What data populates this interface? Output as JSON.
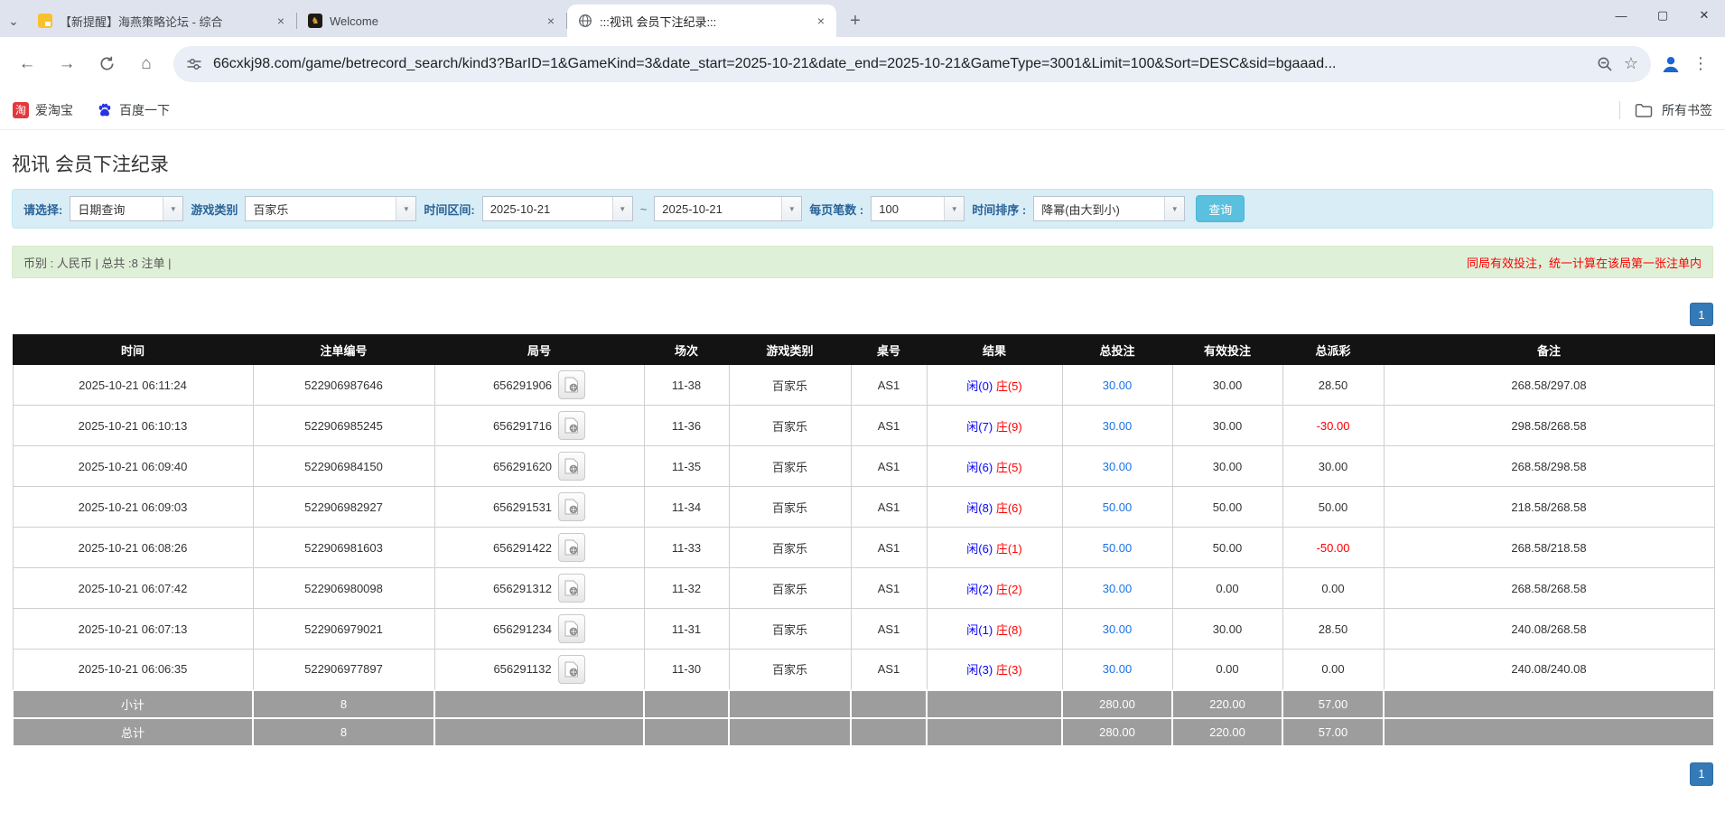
{
  "browser": {
    "tabs": [
      {
        "title": "【新提醒】海燕策略论坛 - 综合",
        "favicon": "yellow-doc-icon"
      },
      {
        "title": "Welcome",
        "favicon": "dark-gold-icon"
      },
      {
        "title": ":::视讯 会员下注纪录:::",
        "favicon": "globe-icon"
      }
    ],
    "new_tab": "+",
    "window_controls": {
      "minimize": "—",
      "maximize": "▢",
      "close": "✕"
    },
    "url": "66cxkj98.com/game/betrecord_search/kind3?BarID=1&GameKind=3&date_start=2025-10-21&date_end=2025-10-21&GameType=3001&Limit=100&Sort=DESC&sid=bgaaad...",
    "bookmarks": [
      {
        "label": "爱淘宝",
        "icon": "taobao-icon",
        "icon_char": "淘"
      },
      {
        "label": "百度一下",
        "icon": "baidu-paw-icon"
      }
    ],
    "all_bookmarks_label": "所有书签"
  },
  "page": {
    "title": "视讯 会员下注纪录",
    "filters": {
      "select_label": "请选择:",
      "select_value": "日期查询",
      "game_type_label": "游戏类别",
      "game_type_value": "百家乐",
      "date_range_label": "时间区间:",
      "date_start": "2025-10-21",
      "date_separator": "~",
      "date_end": "2025-10-21",
      "page_size_label": "每页笔数 :",
      "page_size_value": "100",
      "sort_label": "时间排序 :",
      "sort_value": "降幂(由大到小)",
      "search_button": "查询"
    },
    "summary": {
      "left": "币别 : 人民币 | 总共 :8 注单 |",
      "right": "同局有效投注，统一计算在该局第一张注单内"
    },
    "pagination": {
      "page": "1"
    },
    "table": {
      "headers": [
        "时间",
        "注单编号",
        "局号",
        "场次",
        "游戏类别",
        "桌号",
        "结果",
        "总投注",
        "有效投注",
        "总派彩",
        "备注"
      ],
      "rows": [
        {
          "time": "2025-10-21 06:11:24",
          "bet_id": "522906987646",
          "round_id": "656291906",
          "session": "11-38",
          "game": "百家乐",
          "table": "AS1",
          "player": "闲(0)",
          "banker": "庄(5)",
          "total_bet": "30.00",
          "valid_bet": "30.00",
          "payout": "28.50",
          "note": "268.58/297.08"
        },
        {
          "time": "2025-10-21 06:10:13",
          "bet_id": "522906985245",
          "round_id": "656291716",
          "session": "11-36",
          "game": "百家乐",
          "table": "AS1",
          "player": "闲(7)",
          "banker": "庄(9)",
          "total_bet": "30.00",
          "valid_bet": "30.00",
          "payout": "-30.00",
          "note": "298.58/268.58"
        },
        {
          "time": "2025-10-21 06:09:40",
          "bet_id": "522906984150",
          "round_id": "656291620",
          "session": "11-35",
          "game": "百家乐",
          "table": "AS1",
          "player": "闲(6)",
          "banker": "庄(5)",
          "total_bet": "30.00",
          "valid_bet": "30.00",
          "payout": "30.00",
          "note": "268.58/298.58"
        },
        {
          "time": "2025-10-21 06:09:03",
          "bet_id": "522906982927",
          "round_id": "656291531",
          "session": "11-34",
          "game": "百家乐",
          "table": "AS1",
          "player": "闲(8)",
          "banker": "庄(6)",
          "total_bet": "50.00",
          "valid_bet": "50.00",
          "payout": "50.00",
          "note": "218.58/268.58"
        },
        {
          "time": "2025-10-21 06:08:26",
          "bet_id": "522906981603",
          "round_id": "656291422",
          "session": "11-33",
          "game": "百家乐",
          "table": "AS1",
          "player": "闲(6)",
          "banker": "庄(1)",
          "total_bet": "50.00",
          "valid_bet": "50.00",
          "payout": "-50.00",
          "note": "268.58/218.58"
        },
        {
          "time": "2025-10-21 06:07:42",
          "bet_id": "522906980098",
          "round_id": "656291312",
          "session": "11-32",
          "game": "百家乐",
          "table": "AS1",
          "player": "闲(2)",
          "banker": "庄(2)",
          "total_bet": "30.00",
          "valid_bet": "0.00",
          "payout": "0.00",
          "note": "268.58/268.58"
        },
        {
          "time": "2025-10-21 06:07:13",
          "bet_id": "522906979021",
          "round_id": "656291234",
          "session": "11-31",
          "game": "百家乐",
          "table": "AS1",
          "player": "闲(1)",
          "banker": "庄(8)",
          "total_bet": "30.00",
          "valid_bet": "30.00",
          "payout": "28.50",
          "note": "240.08/268.58"
        },
        {
          "time": "2025-10-21 06:06:35",
          "bet_id": "522906977897",
          "round_id": "656291132",
          "session": "11-30",
          "game": "百家乐",
          "table": "AS1",
          "player": "闲(3)",
          "banker": "庄(3)",
          "total_bet": "30.00",
          "valid_bet": "0.00",
          "payout": "0.00",
          "note": "240.08/240.08"
        }
      ],
      "subtotal": {
        "label": "小计",
        "count": "8",
        "total_bet": "280.00",
        "valid_bet": "220.00",
        "payout": "57.00"
      },
      "total": {
        "label": "总计",
        "count": "8",
        "total_bet": "280.00",
        "valid_bet": "220.00",
        "payout": "57.00"
      }
    },
    "colors": {
      "accent_button": "#5bc0de",
      "pagination": "#337ab7",
      "player_result": "#0703fc",
      "banker_result": "#fd0100",
      "bet_link": "#1a73e8",
      "header_bg": "#131313",
      "footer_bg": "#9d9d9d",
      "filter_bg": "#d9edf7",
      "summary_bg": "#dff0d8"
    }
  }
}
